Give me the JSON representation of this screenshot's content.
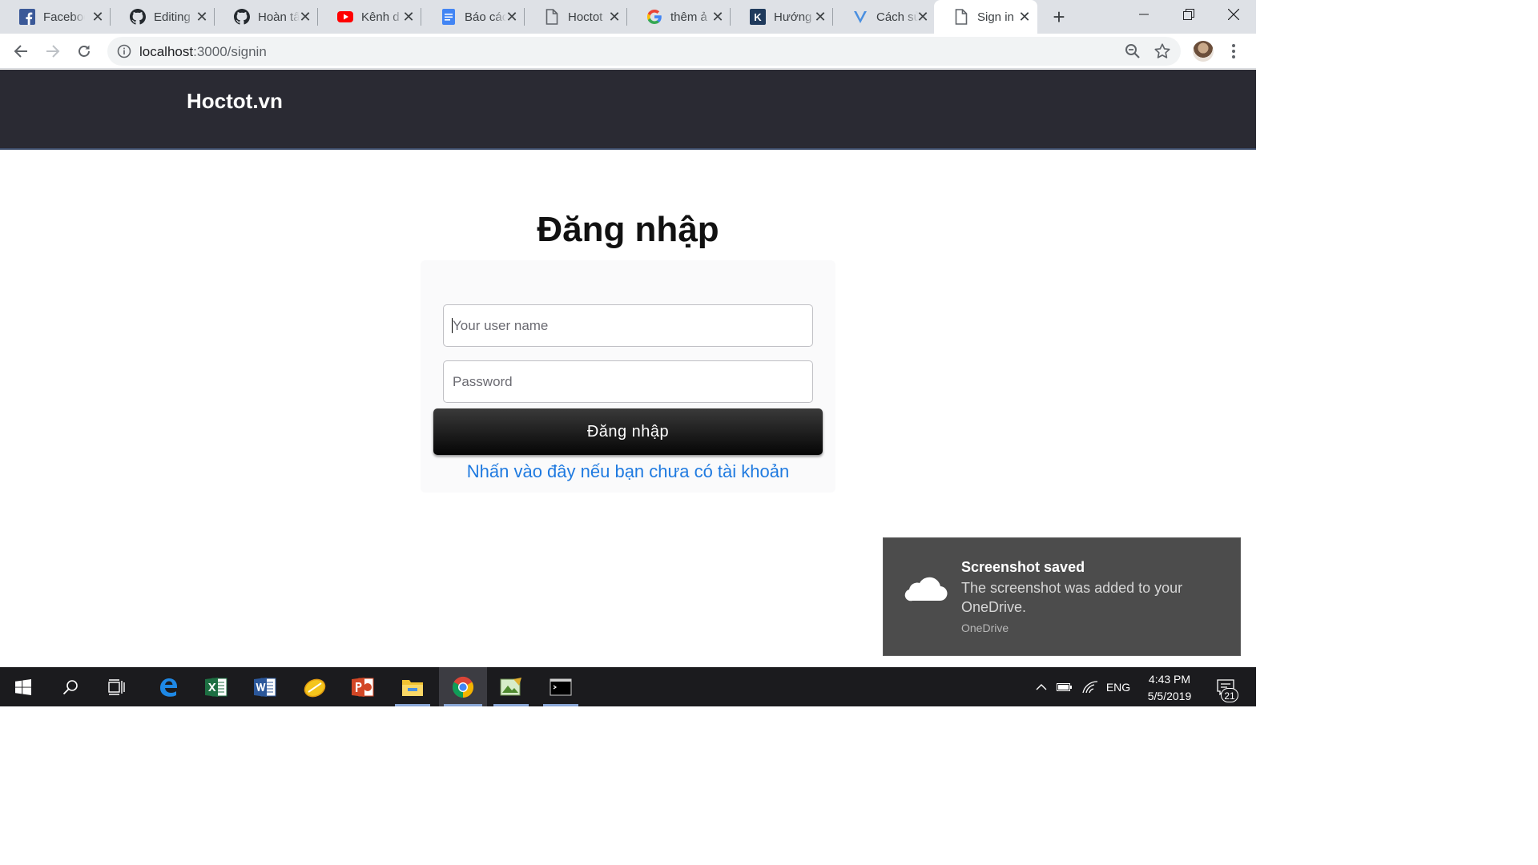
{
  "browser": {
    "tabs": [
      {
        "title": "Facebook",
        "icon": "facebook-icon"
      },
      {
        "title": "Editing",
        "icon": "github-icon"
      },
      {
        "title": "Hoàn tất",
        "icon": "github-icon"
      },
      {
        "title": "Kênh d",
        "icon": "youtube-icon"
      },
      {
        "title": "Báo cáo",
        "icon": "google-docs-icon"
      },
      {
        "title": "Hoctot",
        "icon": "page-icon"
      },
      {
        "title": "thêm ả",
        "icon": "google-icon"
      },
      {
        "title": "Hướng",
        "icon": "k-icon"
      },
      {
        "title": "Cách sử",
        "icon": "v-icon"
      },
      {
        "title": "Sign in",
        "icon": "page-icon",
        "active": true
      }
    ],
    "url_host": "localhost",
    "url_path": ":3000/signin"
  },
  "site": {
    "brand": "Hoctot.vn"
  },
  "signin": {
    "title": "Đăng nhập",
    "username_placeholder": "Your user name",
    "password_placeholder": "Password",
    "submit_label": "Đăng nhập",
    "signup_link": "Nhấn vào đây nếu bạn chưa có tài khoản"
  },
  "toast": {
    "title": "Screenshot saved",
    "message": "The screenshot was added to your OneDrive.",
    "source": "OneDrive"
  },
  "taskbar": {
    "language": "ENG",
    "time": "4:43 PM",
    "date": "5/5/2019",
    "notification_count": "21"
  },
  "colors": {
    "header_bg": "#2a2a33",
    "link": "#1f7ae0",
    "toast_bg": "#4c4c4c",
    "taskbar_bg": "#1b1b1e"
  }
}
